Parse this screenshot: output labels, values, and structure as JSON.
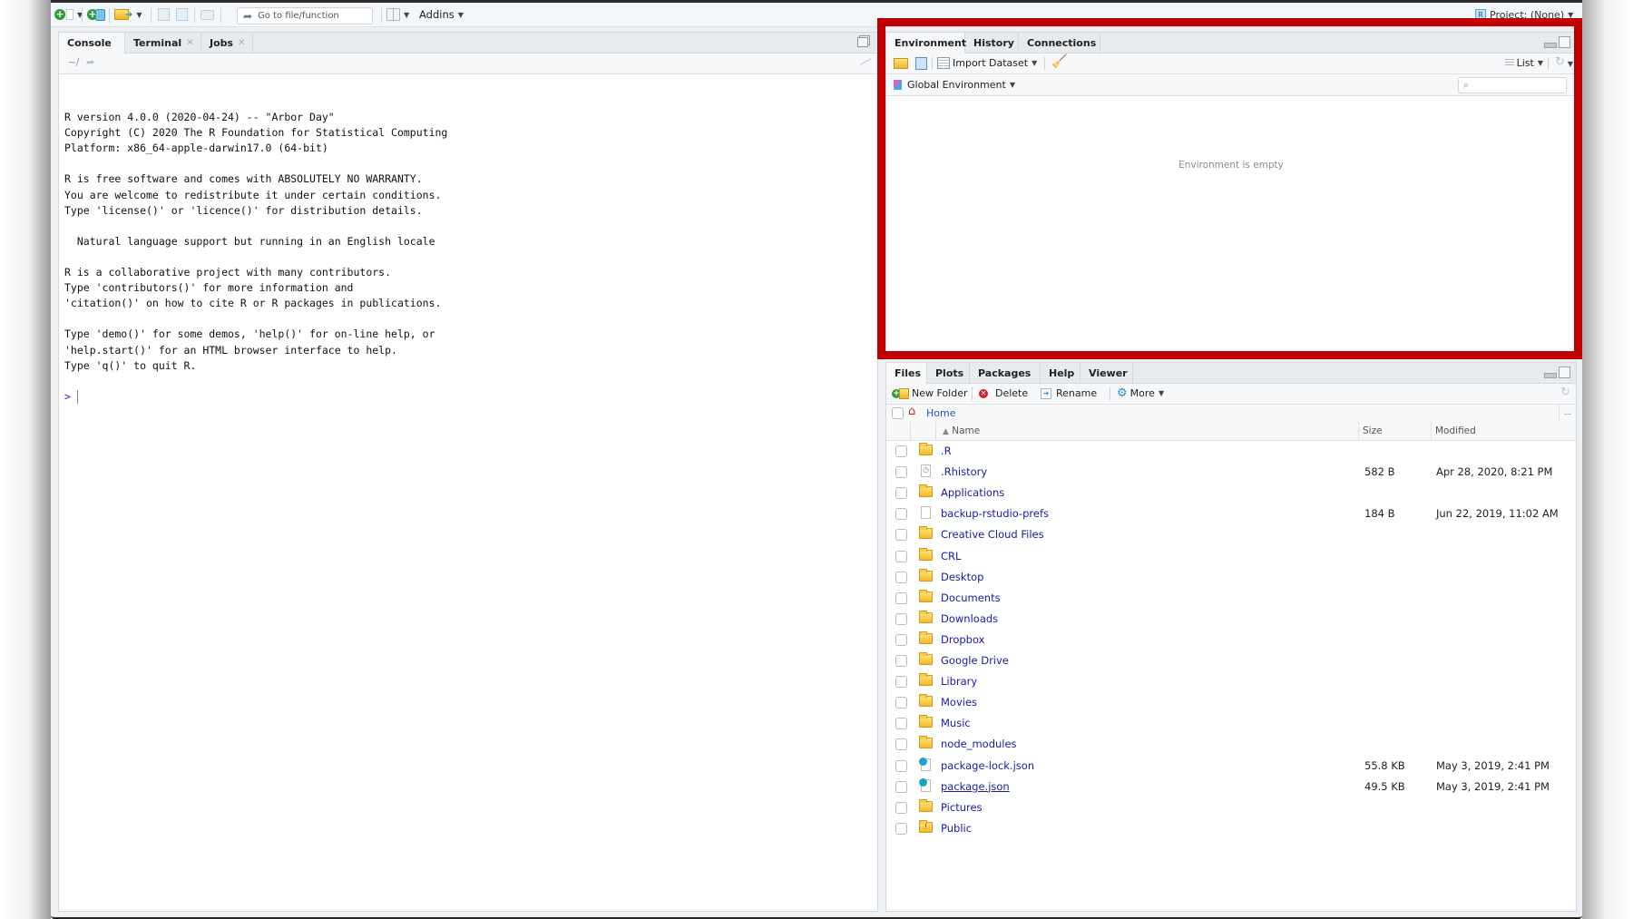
{
  "toolbar": {
    "goto_placeholder": "Go to file/function",
    "addins_label": "Addins",
    "project_label": "Project: (None)"
  },
  "left_pane": {
    "tabs": [
      {
        "label": "Console",
        "active": true,
        "closable": false
      },
      {
        "label": "Terminal",
        "active": false,
        "closable": true
      },
      {
        "label": "Jobs",
        "active": false,
        "closable": true
      }
    ],
    "working_dir": "~/",
    "console_lines": [
      "",
      "R version 4.0.0 (2020-04-24) -- \"Arbor Day\"",
      "Copyright (C) 2020 The R Foundation for Statistical Computing",
      "Platform: x86_64-apple-darwin17.0 (64-bit)",
      "",
      "R is free software and comes with ABSOLUTELY NO WARRANTY.",
      "You are welcome to redistribute it under certain conditions.",
      "Type 'license()' or 'licence()' for distribution details.",
      "",
      "  Natural language support but running in an English locale",
      "",
      "R is a collaborative project with many contributors.",
      "Type 'contributors()' for more information and",
      "'citation()' on how to cite R or R packages in publications.",
      "",
      "Type 'demo()' for some demos, 'help()' for on-line help, or",
      "'help.start()' for an HTML browser interface to help.",
      "Type 'q()' to quit R.",
      ""
    ],
    "prompt": ">"
  },
  "env_pane": {
    "tabs": [
      {
        "label": "Environment",
        "active": true
      },
      {
        "label": "History",
        "active": false
      },
      {
        "label": "Connections",
        "active": false
      }
    ],
    "import_dataset_label": "Import Dataset",
    "list_label": "List",
    "scope_label": "Global Environment",
    "search_placeholder": "",
    "empty_message": "Environment is empty",
    "highlight_color": "#c00000"
  },
  "files_pane": {
    "tabs": [
      {
        "label": "Files",
        "active": true
      },
      {
        "label": "Plots",
        "active": false
      },
      {
        "label": "Packages",
        "active": false
      },
      {
        "label": "Help",
        "active": false
      },
      {
        "label": "Viewer",
        "active": false
      }
    ],
    "new_folder_label": "New Folder",
    "delete_label": "Delete",
    "rename_label": "Rename",
    "more_label": "More",
    "breadcrumb": "Home",
    "more_path": "...",
    "columns": {
      "name": "Name",
      "size": "Size",
      "modified": "Modified"
    },
    "sort_indicator": "▲",
    "files": [
      {
        "name": ".R",
        "type": "folder",
        "size": "",
        "modified": ""
      },
      {
        "name": ".Rhistory",
        "type": "history",
        "size": "582 B",
        "modified": "Apr 28, 2020, 8:21 PM"
      },
      {
        "name": "Applications",
        "type": "folder",
        "size": "",
        "modified": ""
      },
      {
        "name": "backup-rstudio-prefs",
        "type": "file",
        "size": "184 B",
        "modified": "Jun 22, 2019, 11:02 AM"
      },
      {
        "name": "Creative Cloud Files",
        "type": "folder",
        "size": "",
        "modified": ""
      },
      {
        "name": "CRL",
        "type": "folder",
        "size": "",
        "modified": ""
      },
      {
        "name": "Desktop",
        "type": "folder",
        "size": "",
        "modified": ""
      },
      {
        "name": "Documents",
        "type": "folder",
        "size": "",
        "modified": ""
      },
      {
        "name": "Downloads",
        "type": "folder",
        "size": "",
        "modified": ""
      },
      {
        "name": "Dropbox",
        "type": "folder",
        "size": "",
        "modified": ""
      },
      {
        "name": "Google Drive",
        "type": "folder",
        "size": "",
        "modified": ""
      },
      {
        "name": "Library",
        "type": "folder",
        "size": "",
        "modified": ""
      },
      {
        "name": "Movies",
        "type": "folder",
        "size": "",
        "modified": ""
      },
      {
        "name": "Music",
        "type": "folder",
        "size": "",
        "modified": ""
      },
      {
        "name": "node_modules",
        "type": "folder",
        "size": "",
        "modified": ""
      },
      {
        "name": "package-lock.json",
        "type": "json",
        "size": "55.8 KB",
        "modified": "May 3, 2019, 2:41 PM"
      },
      {
        "name": "package.json",
        "type": "json",
        "size": "49.5 KB",
        "modified": "May 3, 2019, 2:41 PM",
        "hovered": true
      },
      {
        "name": "Pictures",
        "type": "folder",
        "size": "",
        "modified": ""
      },
      {
        "name": "Public",
        "type": "public-folder",
        "size": "",
        "modified": ""
      }
    ]
  }
}
